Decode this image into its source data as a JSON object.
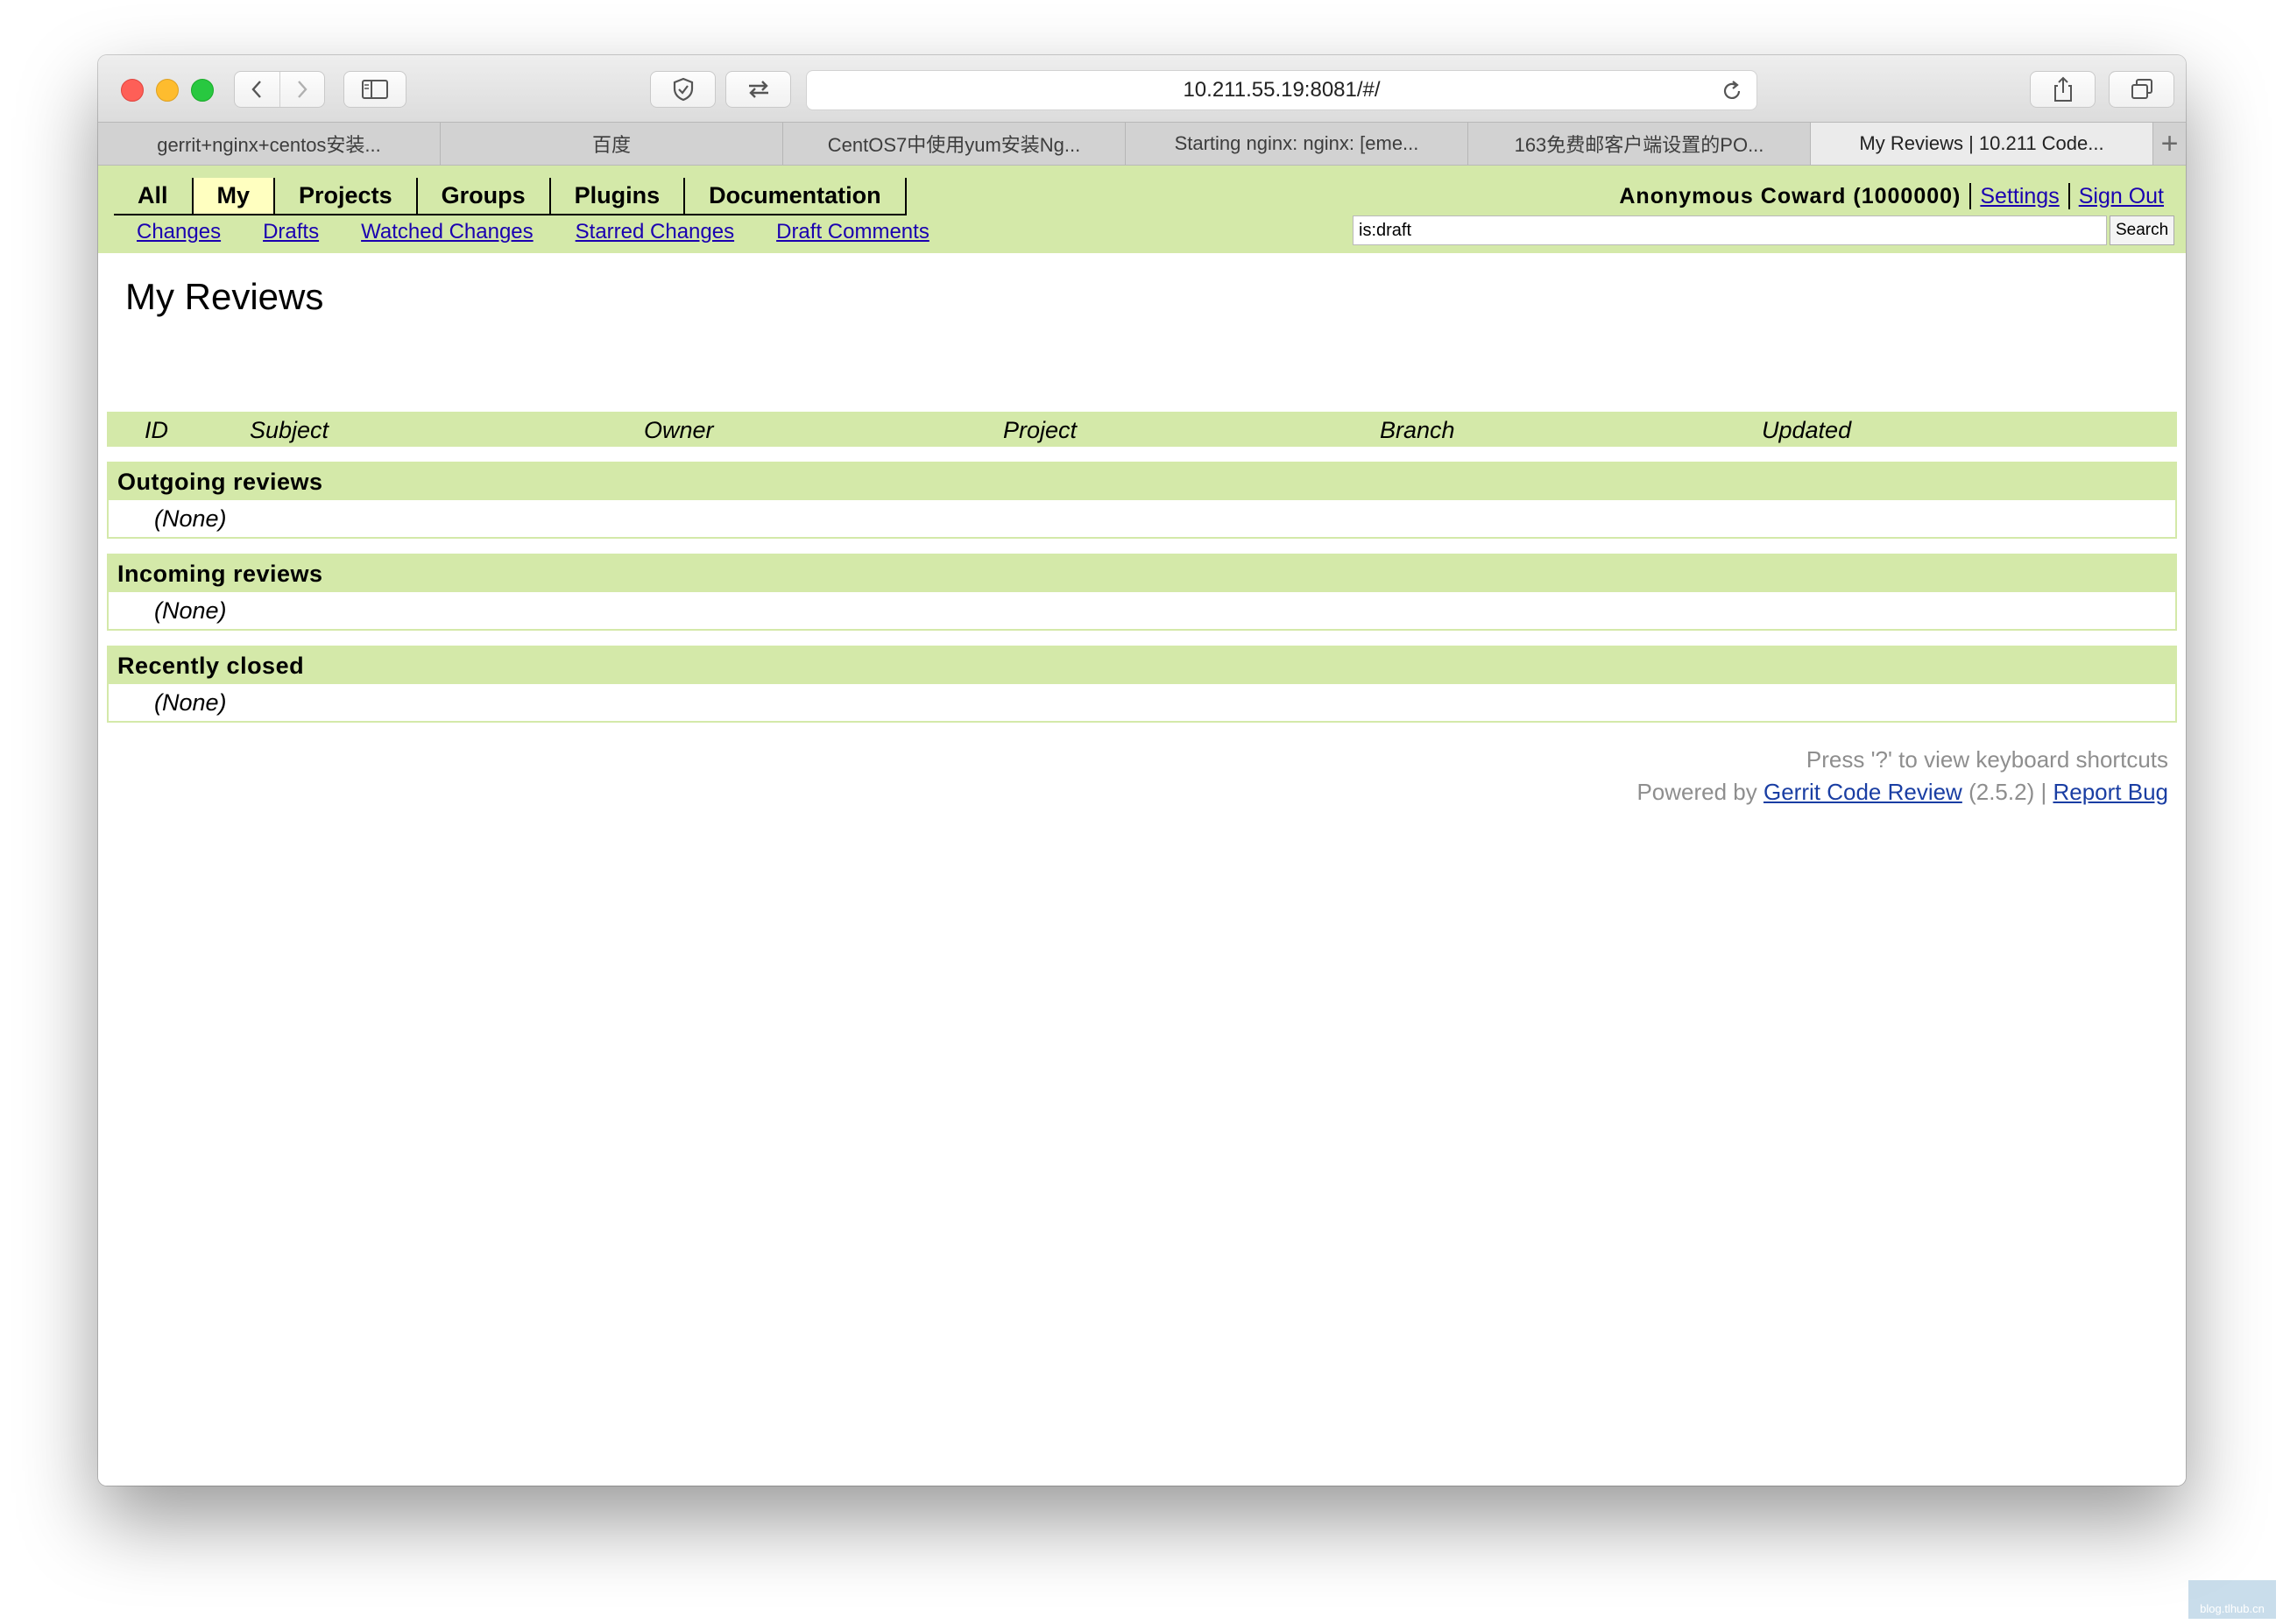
{
  "browser": {
    "url": "10.211.55.19:8081/#/",
    "tabs": [
      {
        "label": "gerrit+nginx+centos安装..."
      },
      {
        "label": "百度"
      },
      {
        "label": "CentOS7中使用yum安装Ng..."
      },
      {
        "label": "Starting nginx: nginx: [eme..."
      },
      {
        "label": "163免费邮客户端设置的PO..."
      },
      {
        "label": "My Reviews | 10.211 Code..."
      }
    ],
    "new_tab_label": "+"
  },
  "gerrit": {
    "menu": [
      "All",
      "My",
      "Projects",
      "Groups",
      "Plugins",
      "Documentation"
    ],
    "selected_menu": "My",
    "submenu": [
      "Changes",
      "Drafts",
      "Watched Changes",
      "Starred Changes",
      "Draft Comments"
    ],
    "user": "Anonymous Coward (1000000)",
    "settings_label": "Settings",
    "signout_label": "Sign Out",
    "search_value": "is:draft",
    "search_button": "Search",
    "page_title": "My Reviews",
    "columns": [
      "ID",
      "Subject",
      "Owner",
      "Project",
      "Branch",
      "Updated"
    ],
    "sections": [
      {
        "title": "Outgoing reviews",
        "empty": "(None)"
      },
      {
        "title": "Incoming reviews",
        "empty": "(None)"
      },
      {
        "title": "Recently closed",
        "empty": "(None)"
      }
    ],
    "footer": {
      "shortcuts_hint": "Press '?' to view keyboard shortcuts",
      "powered_by": "Powered by",
      "gerrit_link": "Gerrit Code Review",
      "version": "(2.5.2)",
      "separator": "|",
      "report_bug": "Report Bug"
    }
  },
  "watermark": "blog.tlhub.cn"
}
